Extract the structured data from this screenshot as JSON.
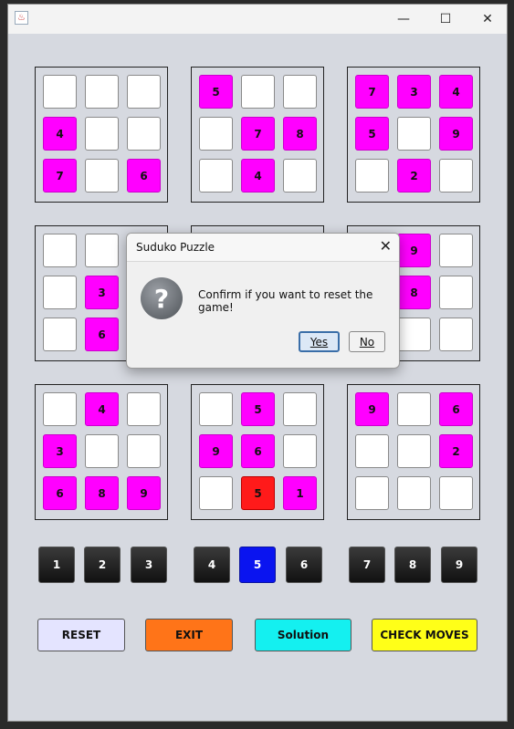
{
  "window": {
    "app_icon": "java-icon",
    "minimize": "—",
    "maximize": "☐",
    "close": "✕"
  },
  "boxes": [
    [
      "",
      "",
      "",
      "4",
      "",
      "",
      "7",
      "",
      "6"
    ],
    [
      "5",
      "",
      "",
      "",
      "7",
      "8",
      "",
      "4",
      ""
    ],
    [
      "7",
      "3",
      "4",
      "5",
      "",
      "9",
      "",
      "2",
      ""
    ],
    [
      "",
      "",
      "",
      "",
      "3",
      "",
      "",
      "6",
      ""
    ],
    [
      "",
      "",
      "",
      "",
      "",
      "",
      "",
      "",
      ""
    ],
    [
      "",
      "9",
      "",
      "",
      "8",
      "",
      "",
      "",
      ""
    ],
    [
      "",
      "4",
      "",
      "3",
      "",
      "",
      "6",
      "8",
      "9"
    ],
    [
      "",
      "5",
      "",
      "9",
      "6",
      "",
      "",
      "5",
      "1"
    ],
    [
      "9",
      "",
      "6",
      "",
      "",
      "2",
      "",
      "",
      ""
    ]
  ],
  "number_buttons": [
    "1",
    "2",
    "3",
    "4",
    "5",
    "6",
    "7",
    "8",
    "9"
  ],
  "selected_number": "5",
  "actions": {
    "reset": "RESET",
    "exit": "EXIT",
    "solution": "Solution",
    "check": "CHECK MOVES"
  },
  "action_colors": {
    "reset": "#e4e4ff",
    "exit": "#ff7418",
    "solution": "#14f0f0",
    "check": "#ffff18"
  },
  "colors": {
    "filled": "#ff00ff",
    "highlight": "#ff1a1a",
    "empty": "#ffffff",
    "selected": "#0a14f0"
  },
  "dialog": {
    "title": "Suduko Puzzle",
    "icon": "question-icon",
    "message": "Confirm if you want to reset the game!",
    "yes": "Yes",
    "no": "No"
  }
}
